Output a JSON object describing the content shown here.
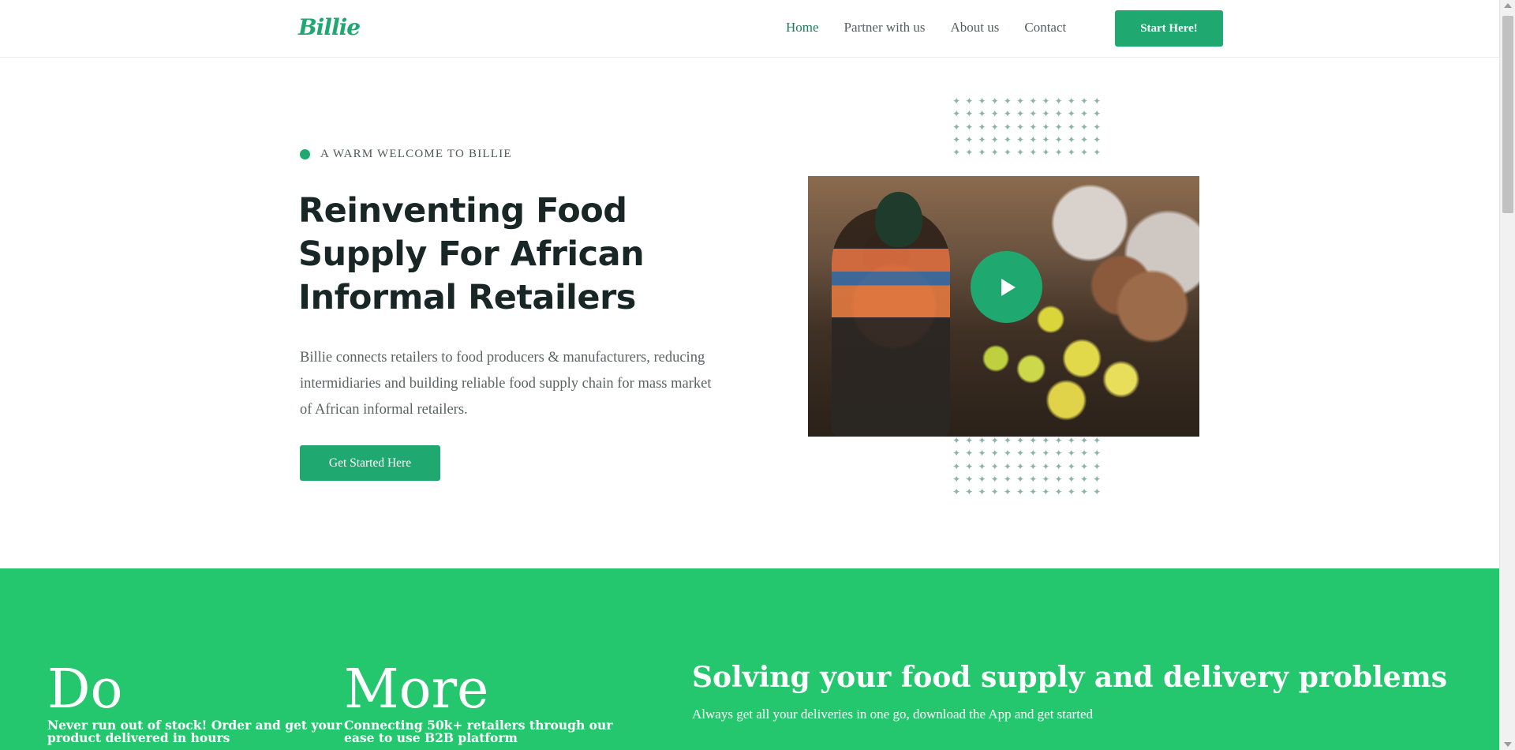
{
  "brand": {
    "logo_text": "Billie",
    "accent": "#1fa870",
    "band_color": "#24c76d"
  },
  "nav": {
    "items": [
      {
        "label": "Home",
        "active": true
      },
      {
        "label": "Partner with us",
        "active": false
      },
      {
        "label": "About us",
        "active": false
      },
      {
        "label": "Contact",
        "active": false
      }
    ],
    "cta_label": "Start Here!"
  },
  "hero": {
    "eyebrow": "A WARM WELCOME TO BILLIE",
    "title": "Reinventing Food Supply For African Informal Retailers",
    "description": "Billie connects retailers to food producers & manufacturers, reducing intermidiaries and building reliable food supply chain for mass market of African informal retailers.",
    "button_label": "Get Started Here",
    "media": {
      "icon": "play-icon"
    }
  },
  "band": {
    "col1": {
      "word": "Do",
      "tag": "Never run out of stock! Order and get your product delivered in hours"
    },
    "col2": {
      "word": "More",
      "tag": "Connecting 50k+ retailers through our ease to use B2B platform"
    },
    "title": "Solving your food supply and delivery problems",
    "subtitle": "Always get all your deliveries in one go, download the App and get started"
  }
}
